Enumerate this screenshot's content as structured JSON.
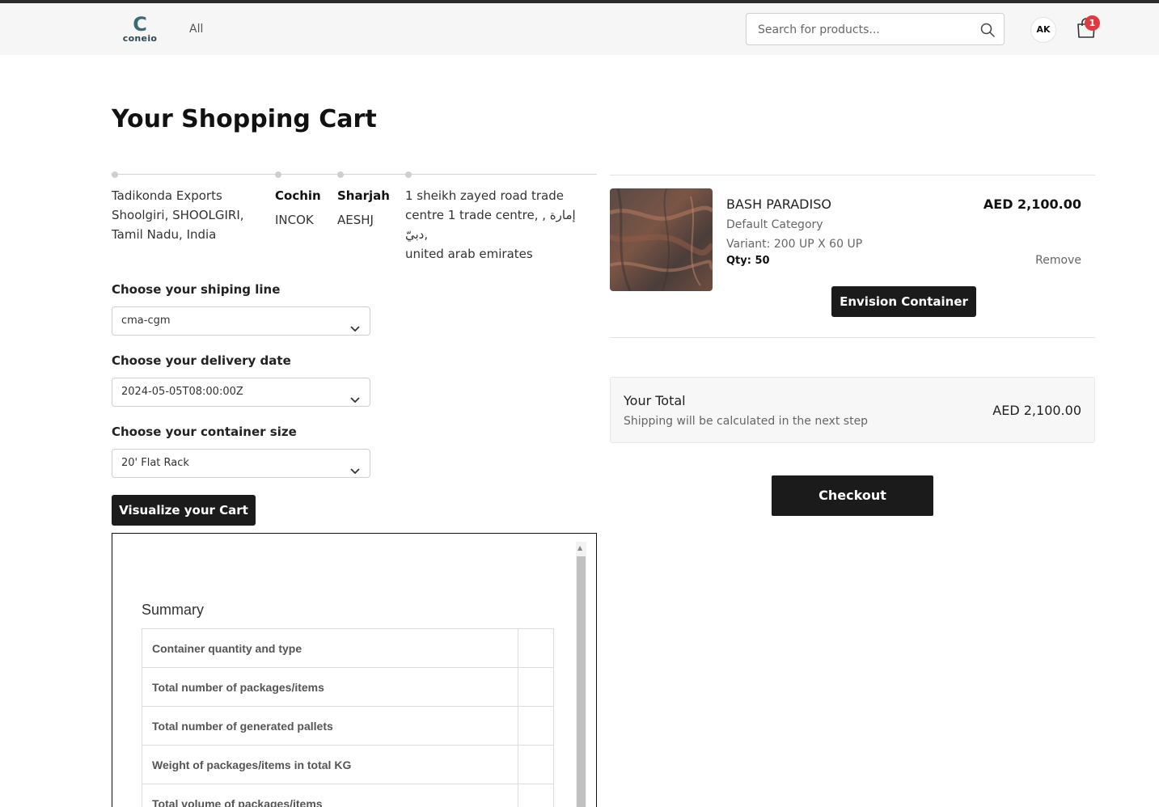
{
  "header": {
    "logo_mark": "C",
    "logo_text": "coneio",
    "nav_all": "All",
    "search_placeholder": "Search for products...",
    "avatar_initials": "AK",
    "cart_count": "1"
  },
  "page": {
    "title": "Your Shopping Cart"
  },
  "route": {
    "origin_name": "Tadikonda Exports",
    "origin_address_1": "Shoolgiri, SHOOLGIRI,",
    "origin_address_2": "Tamil Nadu, India",
    "port_loading_name": "Cochin",
    "port_loading_code": "INCOK",
    "port_discharge_name": "Sharjah",
    "port_discharge_code": "AESHJ",
    "destination_1": "1 sheikh zayed road trade",
    "destination_2": "centre 1 trade centre, , إمارة دبيّ,",
    "destination_3": "united arab emirates"
  },
  "form": {
    "shipping_line_label": "Choose your shiping line",
    "shipping_line_value": "cma-cgm",
    "delivery_date_label": "Choose your delivery date",
    "delivery_date_value": "2024-05-05T08:00:00Z",
    "container_size_label": "Choose your container size",
    "container_size_value": "20' Flat Rack",
    "visualize_button": "Visualize your Cart"
  },
  "visualizer": {
    "summary_title": "Summary",
    "rows": [
      "Container quantity and type",
      "Total number of packages/items",
      "Total number of generated pallets",
      "Weight of packages/items in total KG",
      "Total volume of packages/items"
    ]
  },
  "cart_item": {
    "name": "BASH PARADISO",
    "category": "Default Category",
    "variant": "Variant: 200 UP X 60 UP",
    "qty": "Qty: 50",
    "price": "AED 2,100.00",
    "remove_label": "Remove",
    "envision_button": "Envision Container"
  },
  "totals": {
    "label": "Your Total",
    "note": "Shipping will be calculated in the next step",
    "amount": "AED 2,100.00",
    "checkout_button": "Checkout"
  },
  "colors": {
    "accent_dark": "#1b1b1b",
    "badge_red": "#e0393e",
    "logo_teal": "#3a6b78"
  }
}
